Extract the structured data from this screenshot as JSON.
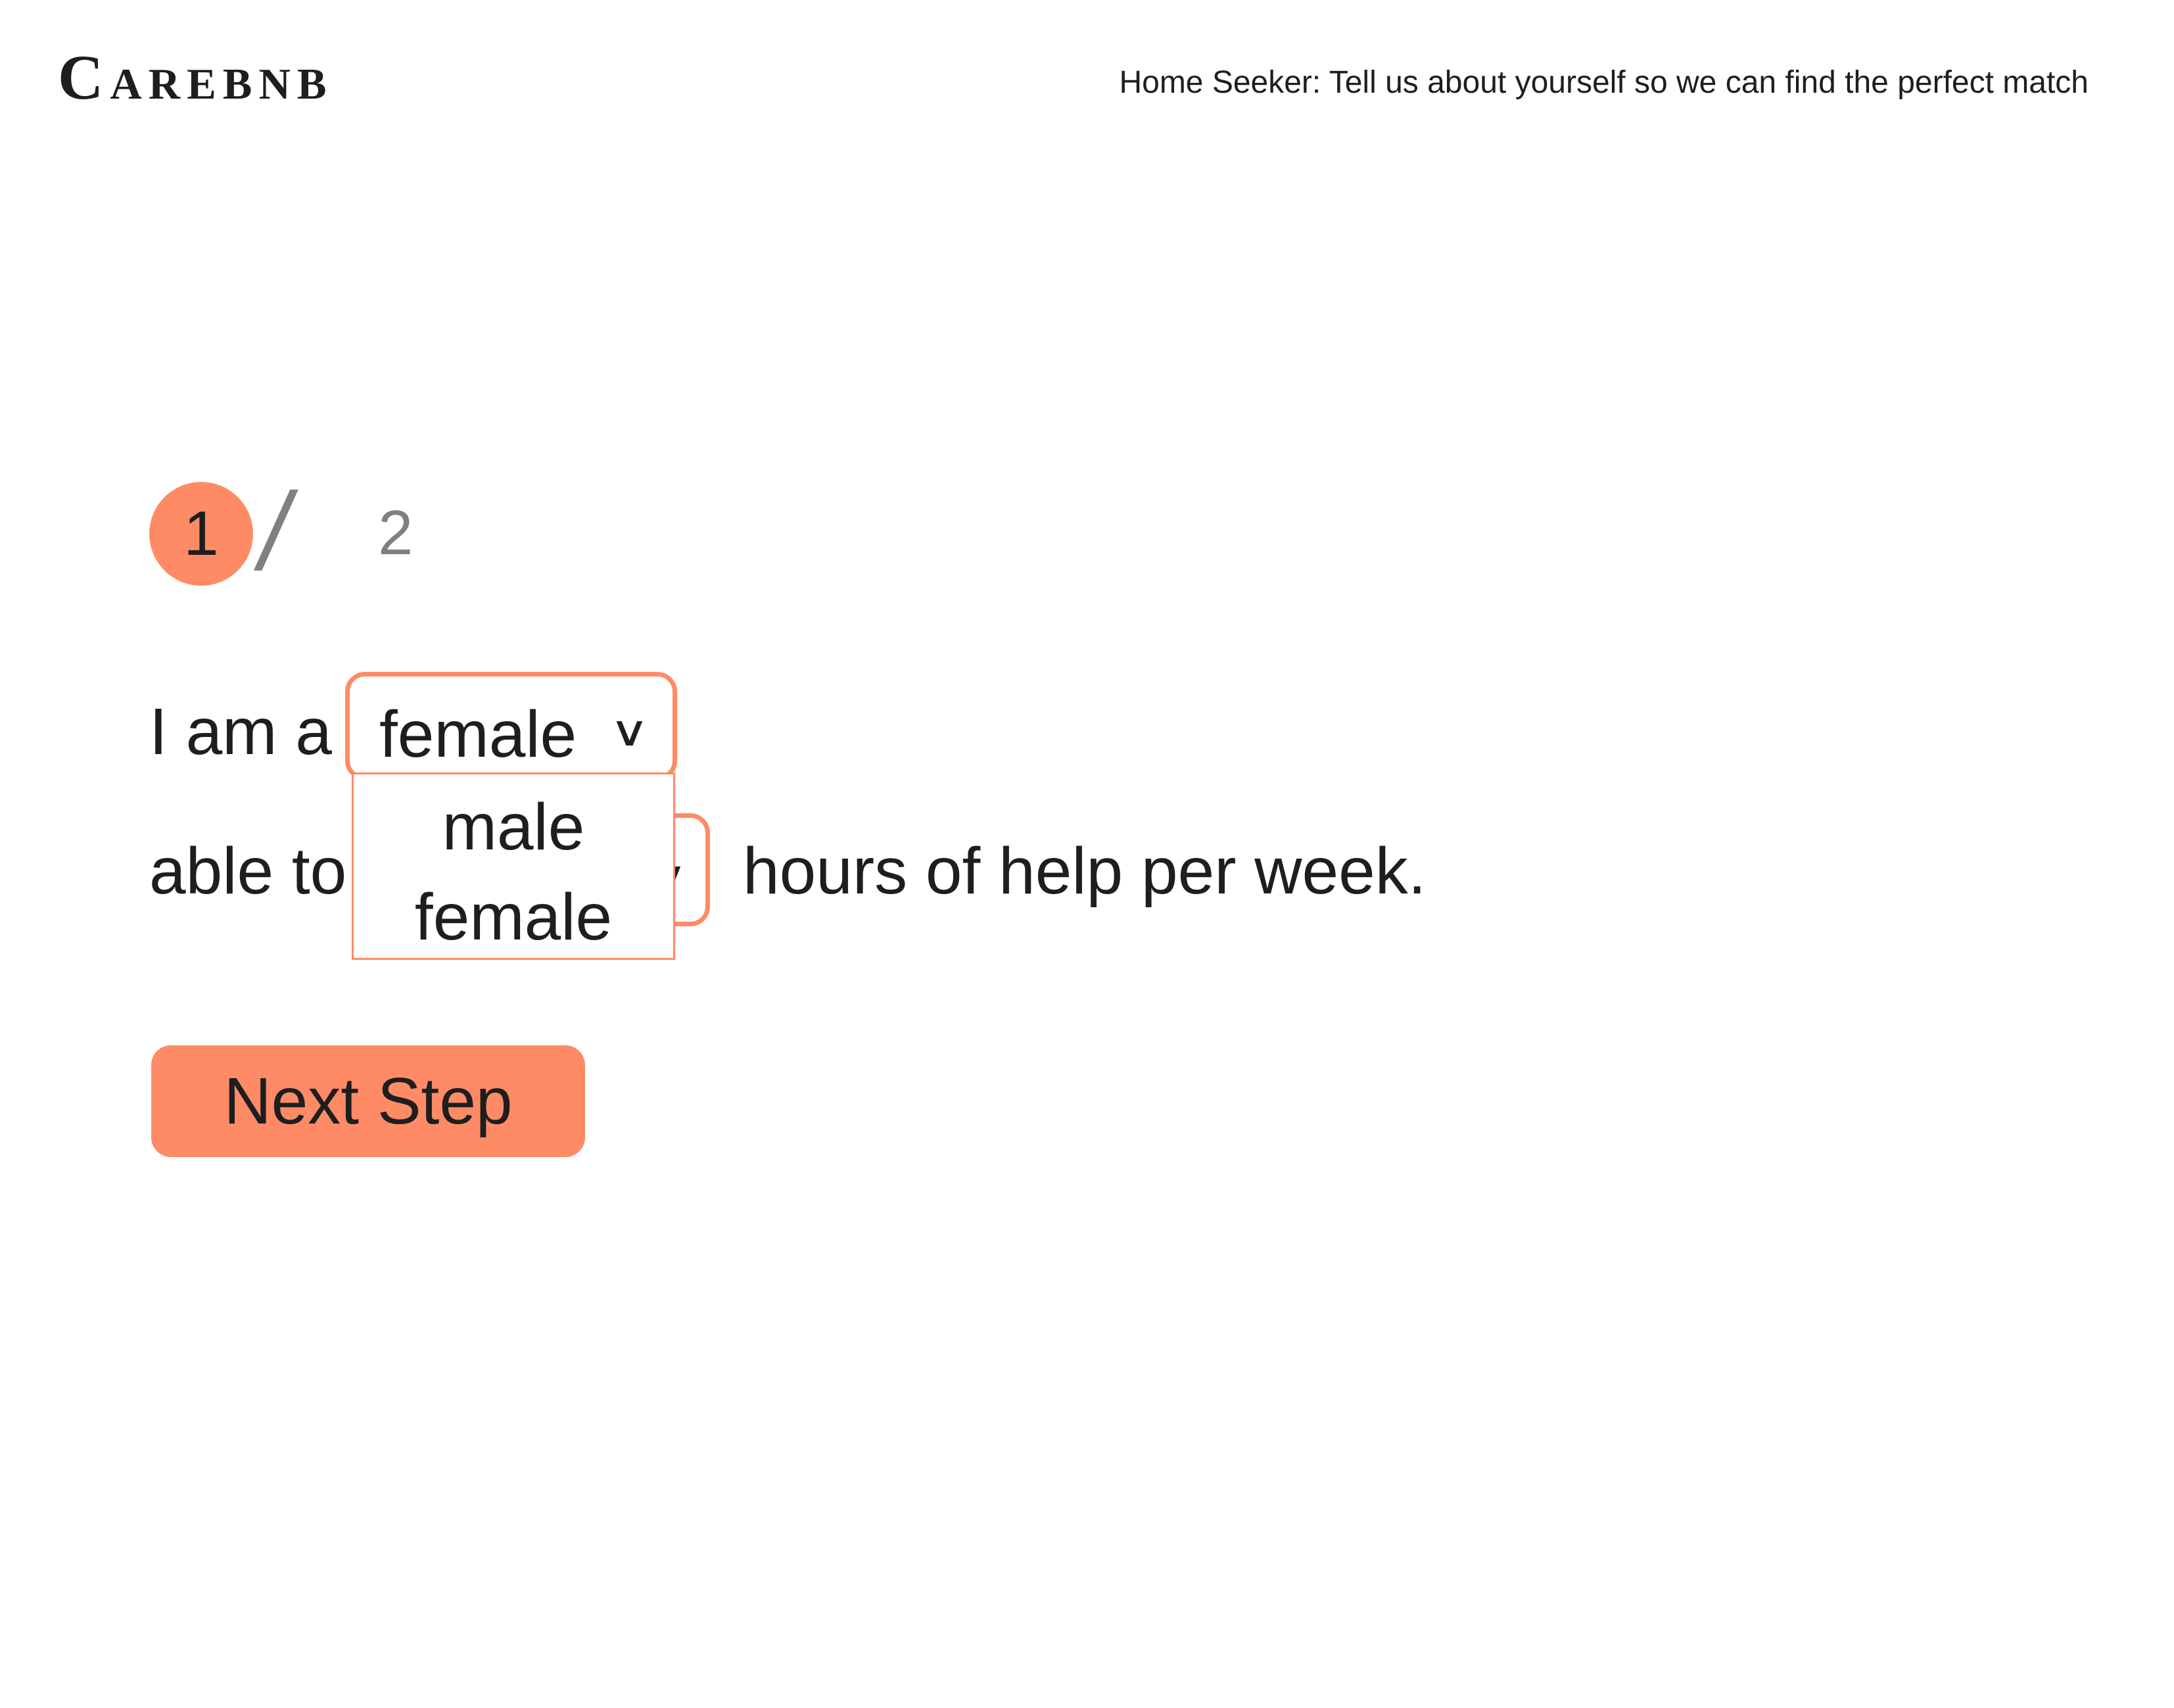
{
  "header": {
    "logo": "Carebnb",
    "tagline": "Home Seeker: Tell us about yourself so we can find the perfect match"
  },
  "stepper": {
    "current": "1",
    "separator": "/",
    "total": "2"
  },
  "form": {
    "sentence_1_prefix": "I am a",
    "gender_select": {
      "value": "female",
      "options": [
        "male",
        "female"
      ]
    },
    "sentence_2_prefix": "able to",
    "sentence_2_suffix": "hours of help per week."
  },
  "next_button": {
    "label": "Next Step"
  },
  "colors": {
    "accent": "#ff8b66",
    "text": "#1e1e1e",
    "muted": "#808080",
    "background": "#ffffff"
  },
  "icons": {
    "dropdown": "chevron-down-icon"
  }
}
